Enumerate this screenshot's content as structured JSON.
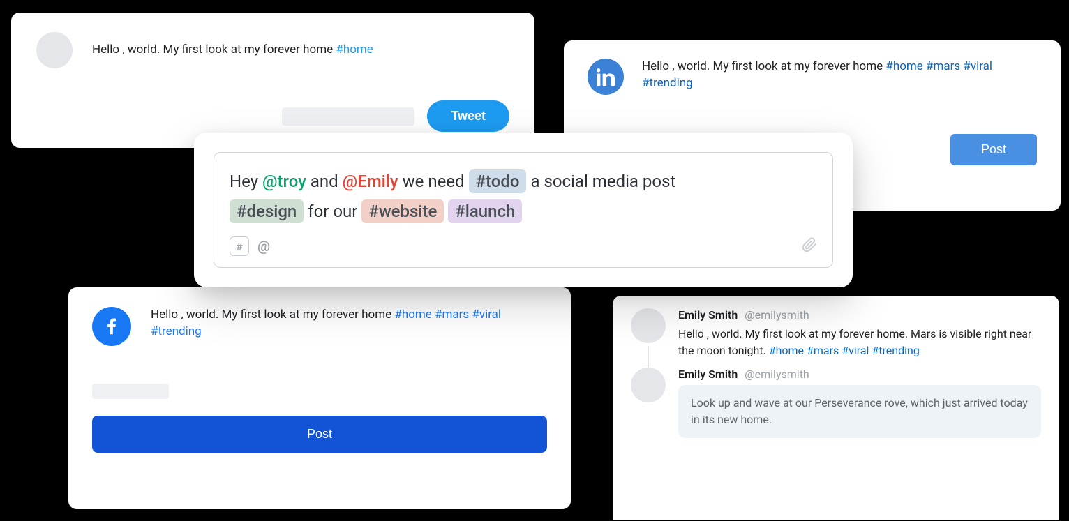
{
  "twitter": {
    "text": "Hello , world. My first look at my forever home ",
    "hashtags": [
      "#home"
    ],
    "button": "Tweet"
  },
  "linkedin": {
    "text": "Hello , world. My first look at my forever home ",
    "hashtags": [
      "#home",
      "#mars",
      "#viral",
      "#trending"
    ],
    "button": "Post"
  },
  "facebook": {
    "text": "Hello , world. My first look at my forever home ",
    "hashtags": [
      "#home",
      "#mars",
      "#viral",
      "#trending"
    ],
    "button": "Post"
  },
  "composer": {
    "part1": "Hey ",
    "mention_troy": "@troy",
    "and": " and ",
    "mention_emily": "@Emily",
    "part2": "  we need  ",
    "tag_todo": "#todo",
    "part3": " a social media post ",
    "tag_design": "#design",
    "part4": "  for our  ",
    "tag_website": "#website",
    "space": "  ",
    "tag_launch": "#launch",
    "hash_symbol": "#",
    "at_symbol": "@"
  },
  "thread": {
    "post1": {
      "name": "Emily Smith",
      "handle": "@emilysmith",
      "text": "Hello , world. My first look at my forever home. Mars is visible right near the moon tonight. ",
      "hashtags": [
        "#home",
        "#mars",
        "#viral",
        "#trending"
      ]
    },
    "post2": {
      "name": "Emily Smith",
      "handle": "@emilysmith",
      "reply": "Look up and wave at our Perseverance rove, which just arrived today in its new home."
    }
  }
}
